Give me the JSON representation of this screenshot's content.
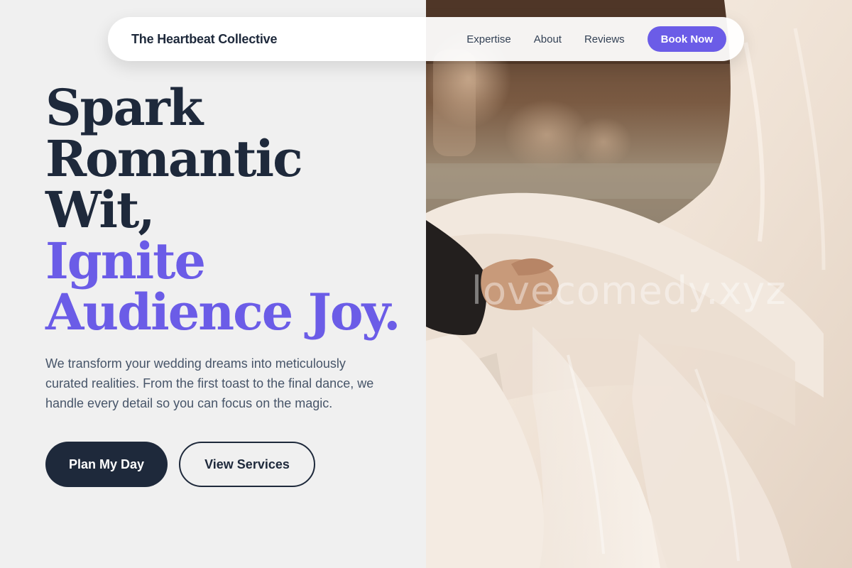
{
  "nav": {
    "brand": "The Heartbeat Collective",
    "links": [
      "Expertise",
      "About",
      "Reviews"
    ],
    "book_label": "Book Now"
  },
  "hero": {
    "headline_dark": [
      "Spark",
      "Romantic",
      "Wit,"
    ],
    "headline_accent": [
      "Ignite",
      "Audience Joy."
    ],
    "subtext": "We transform your wedding dreams into meticulously curated realities. From the first toast to the final dance, we handle every detail so you can focus on the magic.",
    "primary_cta": "Plan My Day",
    "secondary_cta": "View Services"
  },
  "image": {
    "watermark": "lovecomedy.xyz"
  },
  "colors": {
    "background": "#f0f0f0",
    "dark": "#1e293b",
    "accent": "#6b5ce7",
    "body_text": "#475569"
  }
}
